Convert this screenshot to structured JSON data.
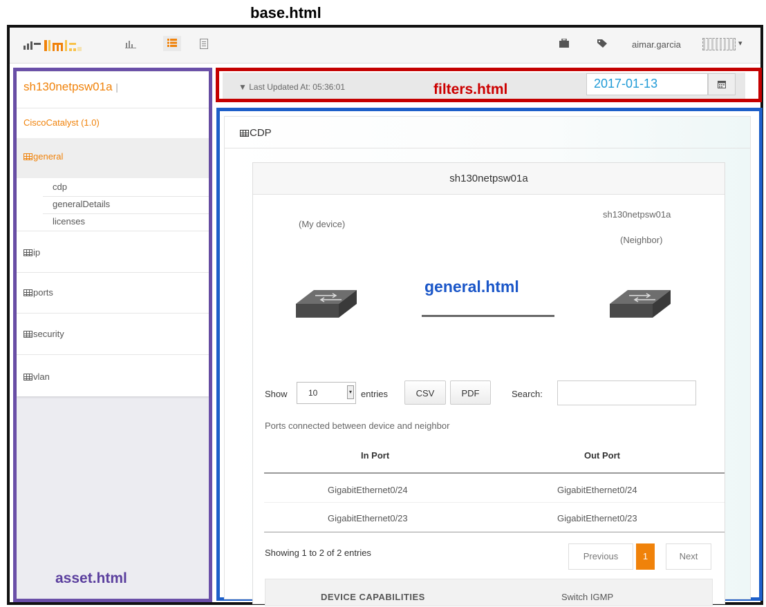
{
  "labels": {
    "base": "base.html",
    "filters": "filters.html",
    "general": "general.html",
    "asset": "asset.html"
  },
  "navbar": {
    "logo_text": "",
    "icons": [
      "bar-chart-icon",
      "list-icon",
      "document-icon",
      "briefcase-icon",
      "tags-icon"
    ],
    "user_name": "aimar.garcia",
    "accent": "#f0820a"
  },
  "asset": {
    "device_name": "sh130netpsw01a",
    "separator": "|",
    "device_type": "CiscoCatalyst (1.0)",
    "menu": [
      {
        "label": "general",
        "active": true,
        "children": [
          "cdp",
          "generalDetails",
          "licenses"
        ]
      },
      {
        "label": "ip"
      },
      {
        "label": "ports"
      },
      {
        "label": "security"
      },
      {
        "label": "vlan"
      }
    ]
  },
  "filters": {
    "last_updated": "Last Updated At: 05:36:01",
    "date": "2017-01-13",
    "date_color": "#1e9ad6"
  },
  "general": {
    "section_title": "CDP",
    "card_title": "sh130netpsw01a",
    "my_device_label": "(My device)",
    "neighbor_name": "sh130netpsw01a",
    "neighbor_label": "(Neighbor)",
    "show_label": "Show",
    "entries_value": "10",
    "entries_label": "entries",
    "csv_label": "CSV",
    "pdf_label": "PDF",
    "search_label": "Search:",
    "search_value": "",
    "caption": "Ports connected between device and neighbor",
    "columns": [
      "In Port",
      "Out Port"
    ],
    "rows": [
      [
        "GigabitEthernet0/24",
        "GigabitEthernet0/24"
      ],
      [
        "GigabitEthernet0/23",
        "GigabitEthernet0/23"
      ]
    ],
    "info": "Showing 1 to 2 of 2 entries",
    "pagination": {
      "prev": "Previous",
      "current": "1",
      "next": "Next"
    },
    "capabilities_label": "DEVICE CAPABILITIES",
    "capabilities_value": "Switch IGMP"
  }
}
